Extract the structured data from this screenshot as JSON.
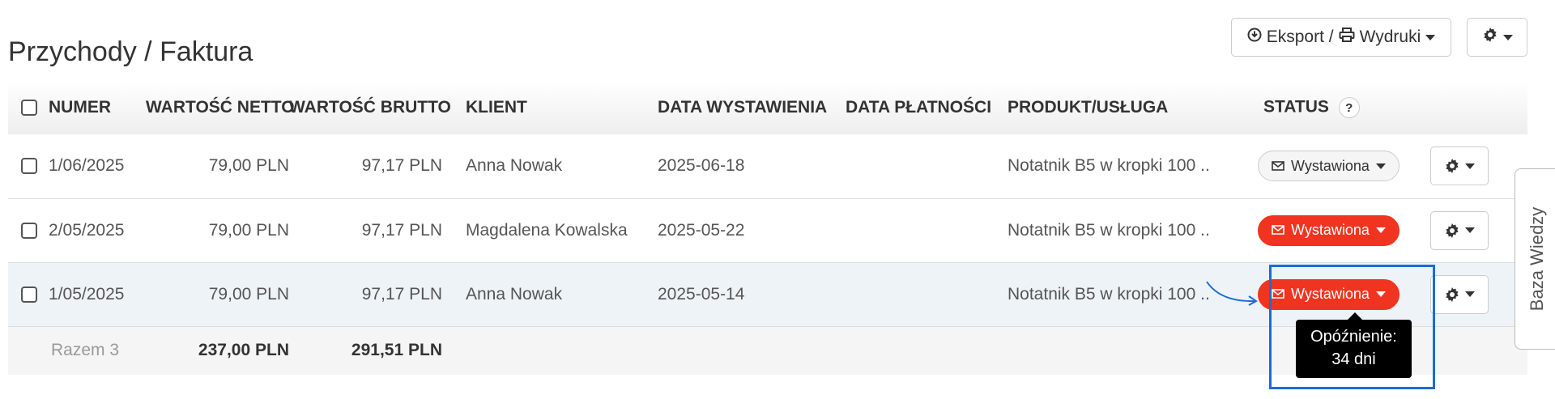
{
  "header": {
    "title": "Przychody / Faktura",
    "export_label": "Eksport / ",
    "print_label": "Wydruki"
  },
  "table": {
    "columns": {
      "numer": "NUMER",
      "netto": "WARTOŚĆ NETTO",
      "brutto": "WARTOŚĆ BRUTTO",
      "klient": "KLIENT",
      "data_wyst": "DATA WYSTAWIENIA",
      "data_plat": "DATA PŁATNOŚCI",
      "produkt": "PRODUKT/USŁUGA",
      "status": "STATUS",
      "status_help": "?"
    },
    "rows": [
      {
        "numer": "1/06/2025",
        "netto": "79,00 PLN",
        "brutto": "97,17 PLN",
        "klient": "Anna Nowak",
        "data_wyst": "2025-06-18",
        "data_plat": "",
        "produkt": "Notatnik B5 w kropki 100 ..",
        "status": "Wystawiona",
        "status_color": "#f5f5f5"
      },
      {
        "numer": "2/05/2025",
        "netto": "79,00 PLN",
        "brutto": "97,17 PLN",
        "klient": "Magdalena Kowalska",
        "data_wyst": "2025-05-22",
        "data_plat": "",
        "produkt": "Notatnik B5 w kropki 100 ..",
        "status": "Wystawiona",
        "status_color": "#f1341f"
      },
      {
        "numer": "1/05/2025",
        "netto": "79,00 PLN",
        "brutto": "97,17 PLN",
        "klient": "Anna Nowak",
        "data_wyst": "2025-05-14",
        "data_plat": "",
        "produkt": "Notatnik B5 w kropki 100 ..",
        "status": "Wystawiona",
        "status_color": "#f1341f"
      }
    ],
    "summary": {
      "label": "Razem 3",
      "netto": "237,00 PLN",
      "brutto": "291,51 PLN"
    }
  },
  "tooltip": {
    "line1": "Opóźnienie:",
    "line2": "34 dni"
  },
  "side_tab": {
    "label": "Baza Wiedzy"
  },
  "colors": {
    "status_overdue": "#f1341f",
    "highlight": "#1c6ad8"
  }
}
